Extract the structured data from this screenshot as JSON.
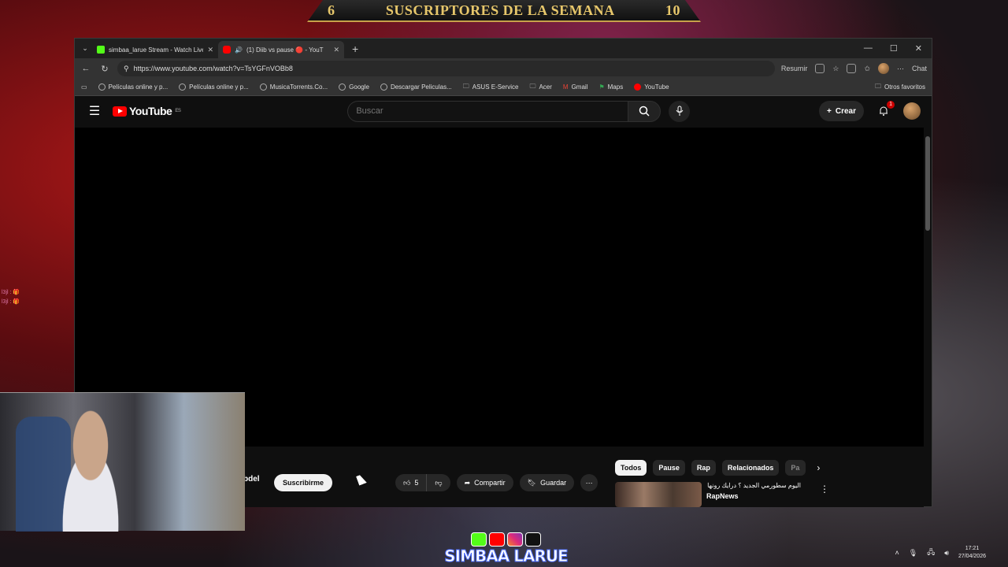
{
  "banner": {
    "left_num": "6",
    "title": "SUSCRIPTORES DE LA SEMANA",
    "right_num": "10"
  },
  "browser": {
    "tabs": [
      {
        "title": "simbaa_larue Stream - Watch Live",
        "active": false,
        "color": "#53fc18"
      },
      {
        "title": "(1) Diib vs pause 🔴 - YouT",
        "active": true,
        "color": "#ff0000"
      }
    ],
    "url": "https://www.youtube.com/watch?v=TsYGFnVOBb8",
    "address_right": {
      "summarize": "Resumir",
      "chat": "Chat"
    },
    "bookmarks": [
      "Películas online y p...",
      "Películas online y p...",
      "MusicaTorrents.Co...",
      "Google",
      "Descargar Peliculas...",
      "ASUS E-Service",
      "Acer",
      "Gmail",
      "Maps",
      "YouTube"
    ],
    "other_favorites": "Otros favoritos"
  },
  "youtube": {
    "logo": "YouTube",
    "region": "ES",
    "search_placeholder": "Buscar",
    "create": "Crear",
    "notifications": "1",
    "channel_fragment": "bdel",
    "subscribe": "Suscribirme",
    "likes": "5",
    "share": "Compartir",
    "save": "Guardar",
    "chips": [
      "Todos",
      "Pause",
      "Rap",
      "Relacionados",
      "Pa"
    ],
    "recommendation": {
      "title": "اليوم سطورمي الجديد ؟ درايك رونها ؟",
      "channel": "RapNews"
    }
  },
  "overlay": {
    "chat": [
      "l3jl : 🎁",
      "l3jl : 🎁"
    ],
    "logo_text": "SIMBAA LARUE",
    "tray_time": "17:21",
    "tray_date": "27/04/2026"
  }
}
